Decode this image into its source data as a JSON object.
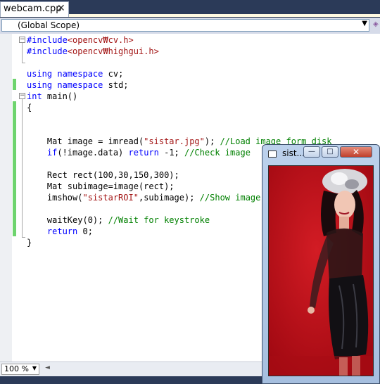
{
  "tab": {
    "label": "webcam.cpp",
    "close": "✕"
  },
  "scope": {
    "value": "(Global Scope)"
  },
  "code": {
    "lines": [
      [
        {
          "t": "#include",
          "c": "pp"
        },
        {
          "t": "<opencv₩cv.h>",
          "c": "str"
        }
      ],
      [
        {
          "t": "#include",
          "c": "pp"
        },
        {
          "t": "<opencv₩highgui.h>",
          "c": "str"
        }
      ],
      [],
      [
        {
          "t": "using",
          "c": "kw"
        },
        {
          "t": " "
        },
        {
          "t": "namespace",
          "c": "kw"
        },
        {
          "t": " cv;"
        }
      ],
      [
        {
          "t": "using",
          "c": "kw"
        },
        {
          "t": " "
        },
        {
          "t": "namespace",
          "c": "kw"
        },
        {
          "t": " std;"
        }
      ],
      [
        {
          "t": "int",
          "c": "kw"
        },
        {
          "t": " main()"
        }
      ],
      [
        {
          "t": "{"
        }
      ],
      [],
      [],
      [
        {
          "t": "    Mat image = imread("
        },
        {
          "t": "\"sistar.jpg\"",
          "c": "str"
        },
        {
          "t": "); "
        },
        {
          "t": "//Load image form disk",
          "c": "cmt"
        }
      ],
      [
        {
          "t": "    "
        },
        {
          "t": "if",
          "c": "kw"
        },
        {
          "t": "(!image.data) "
        },
        {
          "t": "return",
          "c": "kw"
        },
        {
          "t": " -1; "
        },
        {
          "t": "//Check image",
          "c": "cmt"
        }
      ],
      [],
      [
        {
          "t": "    Rect rect(100,30,150,300);"
        }
      ],
      [
        {
          "t": "    Mat subimage=image(rect);"
        }
      ],
      [
        {
          "t": "    imshow("
        },
        {
          "t": "\"sistarROI\"",
          "c": "str"
        },
        {
          "t": ",subimage); "
        },
        {
          "t": "//Show image",
          "c": "cmt"
        }
      ],
      [],
      [
        {
          "t": "    waitKey(0); "
        },
        {
          "t": "//Wait for keystroke",
          "c": "cmt"
        }
      ],
      [
        {
          "t": "    "
        },
        {
          "t": "return",
          "c": "kw"
        },
        {
          "t": " 0;"
        }
      ],
      [
        {
          "t": "}"
        }
      ]
    ]
  },
  "status": {
    "zoom": "100 %"
  },
  "window": {
    "title": "sist...",
    "minimize": "—",
    "maximize": "□",
    "close": "✕"
  },
  "icons": [
    "close-icon",
    "chevron-down-icon",
    "fold-minus-icon",
    "window-app-icon",
    "minimize-icon",
    "maximize-icon"
  ]
}
